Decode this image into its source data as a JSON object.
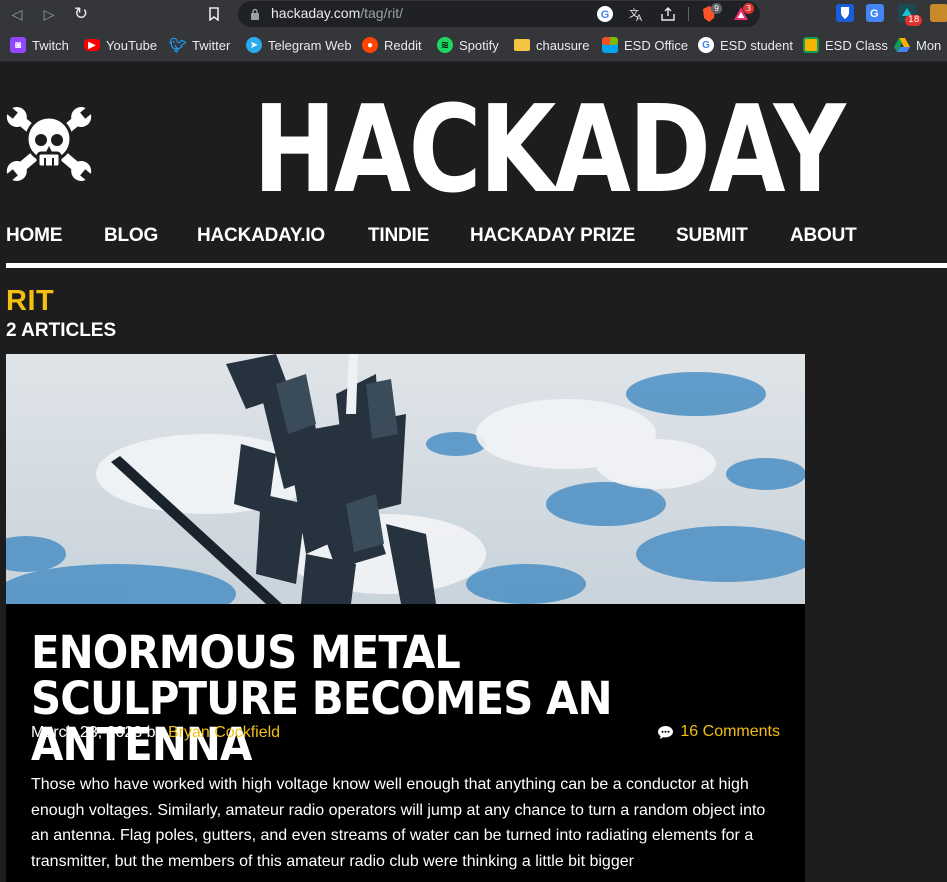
{
  "browser": {
    "url_host": "hackaday.com",
    "url_path": "/tag/rit/",
    "extension_badges": {
      "brave_shields": "9",
      "brave_rewards": "3",
      "notifications": "18"
    }
  },
  "bookmarks": [
    {
      "label": "Twitch",
      "color": "#9146ff",
      "icon": "twitch-icon"
    },
    {
      "label": "YouTube",
      "color": "#ff0000",
      "icon": "youtube-icon"
    },
    {
      "label": "Twitter",
      "color": "#1d9bf0",
      "icon": "twitter-icon"
    },
    {
      "label": "Telegram Web",
      "color": "#2aabee",
      "icon": "telegram-icon"
    },
    {
      "label": "Reddit",
      "color": "#ff4500",
      "icon": "reddit-icon"
    },
    {
      "label": "Spotify",
      "color": "#1ed760",
      "icon": "spotify-icon"
    },
    {
      "label": "chausure",
      "color": "#f4c542",
      "icon": "folder-icon"
    },
    {
      "label": "ESD Office",
      "color": "#f25022",
      "icon": "microsoft-icon"
    },
    {
      "label": "ESD student",
      "color": "#4285f4",
      "icon": "google-icon"
    },
    {
      "label": "ESD Class",
      "color": "#f4b400",
      "icon": "classroom-icon"
    },
    {
      "label": "Mon",
      "color": "#0f9d58",
      "icon": "drive-icon"
    }
  ],
  "site": {
    "name": "HACKADAY",
    "nav": [
      "HOME",
      "BLOG",
      "HACKADAY.IO",
      "TINDIE",
      "HACKADAY PRIZE",
      "SUBMIT",
      "ABOUT"
    ]
  },
  "tag": {
    "title": "RIT",
    "count": "2 ARTICLES"
  },
  "article": {
    "title": "ENORMOUS METAL SCULPTURE BECOMES AN ANTENNA",
    "date": "March 23, 2023",
    "by": "by",
    "author": "Bryan Cockfield",
    "comments": "16 Comments",
    "excerpt": "Those who have worked with high voltage know well enough that anything can be a conductor at high enough voltages. Similarly, amateur radio operators will jump at any chance to turn a random object into an antenna. Flag poles, gutters, and even streams of water can be turned into radiating elements for a transmitter, but the members of this amateur radio club were thinking a little bit bigger"
  },
  "colors": {
    "accent": "#f3bf10",
    "page_bg": "#1d1d1d",
    "card_bg": "#000000"
  }
}
